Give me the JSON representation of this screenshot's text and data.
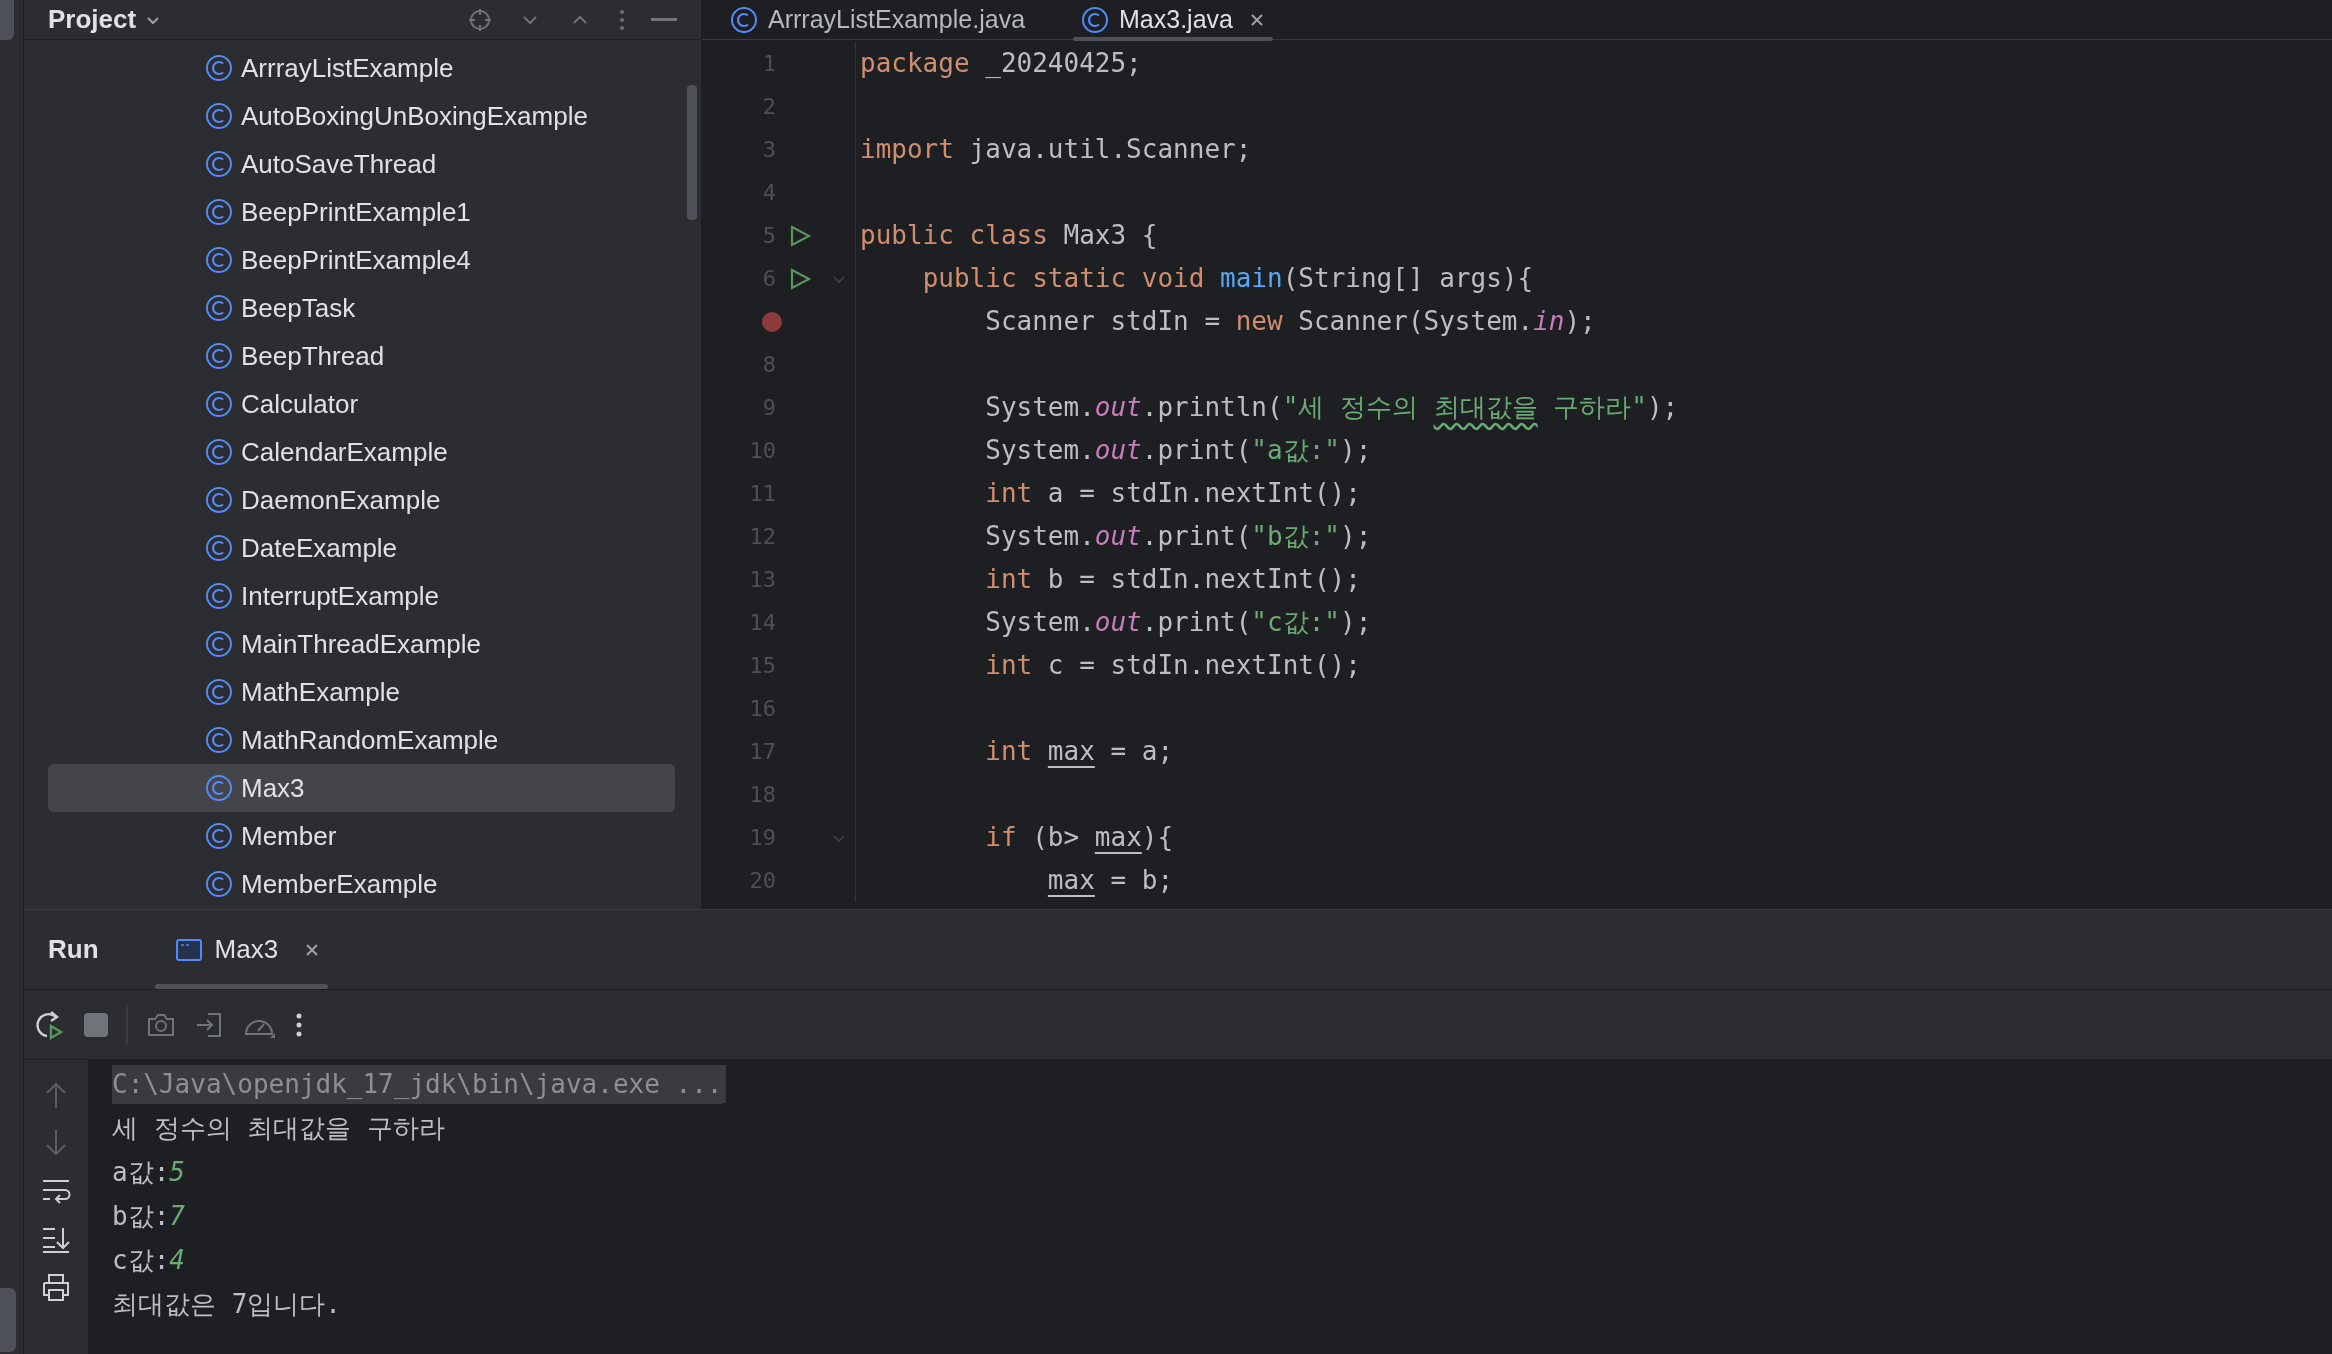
{
  "project_panel": {
    "title": "Project",
    "items": [
      {
        "label": "ArrrayListExample",
        "selected": false
      },
      {
        "label": "AutoBoxingUnBoxingExample",
        "selected": false
      },
      {
        "label": "AutoSaveThread",
        "selected": false
      },
      {
        "label": "BeepPrintExample1",
        "selected": false
      },
      {
        "label": "BeepPrintExample4",
        "selected": false
      },
      {
        "label": "BeepTask",
        "selected": false
      },
      {
        "label": "BeepThread",
        "selected": false
      },
      {
        "label": "Calculator",
        "selected": false
      },
      {
        "label": "CalendarExample",
        "selected": false
      },
      {
        "label": "DaemonExample",
        "selected": false
      },
      {
        "label": "DateExample",
        "selected": false
      },
      {
        "label": "InterruptExample",
        "selected": false
      },
      {
        "label": "MainThreadExample",
        "selected": false
      },
      {
        "label": "MathExample",
        "selected": false
      },
      {
        "label": "MathRandomExample",
        "selected": false
      },
      {
        "label": "Max3",
        "selected": true
      },
      {
        "label": "Member",
        "selected": false
      },
      {
        "label": "MemberExample",
        "selected": false
      }
    ]
  },
  "editor": {
    "tabs": [
      {
        "label": "ArrrayListExample.java",
        "selected": false
      },
      {
        "label": "Max3.java",
        "selected": true
      }
    ],
    "lines": [
      {
        "number": "1",
        "kind": "plain",
        "fold": false,
        "tokens": [
          {
            "text": "package",
            "kind": "keyword"
          },
          {
            "text": " _20240425;",
            "kind": "plain"
          }
        ]
      },
      {
        "number": "2",
        "kind": "plain",
        "fold": false
      },
      {
        "number": "3",
        "kind": "plain",
        "fold": false,
        "tokens": [
          {
            "text": "import",
            "kind": "keyword"
          },
          {
            "text": " java.util.Scanner;",
            "kind": "plain"
          }
        ]
      },
      {
        "number": "4",
        "kind": "plain",
        "fold": false
      },
      {
        "number": "5",
        "kind": "run",
        "fold": false,
        "tokens": [
          {
            "text": "public class",
            "kind": "keyword"
          },
          {
            "text": " Max3 {",
            "kind": "plain"
          }
        ]
      },
      {
        "number": "6",
        "kind": "run",
        "fold": true,
        "tokens": [
          {
            "text": "    public static void ",
            "kind": "keyword"
          },
          {
            "text": "main",
            "kind": "method"
          },
          {
            "text": "(String[] args){",
            "kind": "plain"
          }
        ]
      },
      {
        "kind": "breakpoint",
        "fold": false,
        "tokens": [
          {
            "text": "        Scanner stdIn = ",
            "kind": "plain"
          },
          {
            "text": "new",
            "kind": "keyword"
          },
          {
            "text": " Scanner(System.",
            "kind": "plain"
          },
          {
            "text": "in",
            "kind": "field"
          },
          {
            "text": ");",
            "kind": "plain"
          }
        ]
      },
      {
        "number": "8",
        "kind": "plain",
        "fold": false
      },
      {
        "number": "9",
        "kind": "plain",
        "fold": false,
        "tokens": [
          {
            "text": "        System.",
            "kind": "plain"
          },
          {
            "text": "out",
            "kind": "field"
          },
          {
            "text": ".println(",
            "kind": "plain"
          },
          {
            "text": "\"세 정수의 ",
            "kind": "string"
          },
          {
            "text": "최대값을",
            "kind": "typo"
          },
          {
            "text": " 구하라\"",
            "kind": "string"
          },
          {
            "text": ");",
            "kind": "plain"
          }
        ]
      },
      {
        "number": "10",
        "kind": "plain",
        "fold": false,
        "tokens": [
          {
            "text": "        System.",
            "kind": "plain"
          },
          {
            "text": "out",
            "kind": "field"
          },
          {
            "text": ".print(",
            "kind": "plain"
          },
          {
            "text": "\"a값:\"",
            "kind": "string"
          },
          {
            "text": ");",
            "kind": "plain"
          }
        ]
      },
      {
        "number": "11",
        "kind": "plain",
        "fold": false,
        "tokens": [
          {
            "text": "        int",
            "kind": "keyword"
          },
          {
            "text": " a = stdIn.nextInt();",
            "kind": "plain"
          }
        ]
      },
      {
        "number": "12",
        "kind": "plain",
        "fold": false,
        "tokens": [
          {
            "text": "        System.",
            "kind": "plain"
          },
          {
            "text": "out",
            "kind": "field"
          },
          {
            "text": ".print(",
            "kind": "plain"
          },
          {
            "text": "\"b값:\"",
            "kind": "string"
          },
          {
            "text": ");",
            "kind": "plain"
          }
        ]
      },
      {
        "number": "13",
        "kind": "plain",
        "fold": false,
        "tokens": [
          {
            "text": "        int",
            "kind": "keyword"
          },
          {
            "text": " b = stdIn.nextInt();",
            "kind": "plain"
          }
        ]
      },
      {
        "number": "14",
        "kind": "plain",
        "fold": false,
        "tokens": [
          {
            "text": "        System.",
            "kind": "plain"
          },
          {
            "text": "out",
            "kind": "field"
          },
          {
            "text": ".print(",
            "kind": "plain"
          },
          {
            "text": "\"c값:\"",
            "kind": "string"
          },
          {
            "text": ");",
            "kind": "plain"
          }
        ]
      },
      {
        "number": "15",
        "kind": "plain",
        "fold": false,
        "tokens": [
          {
            "text": "        int",
            "kind": "keyword"
          },
          {
            "text": " c = stdIn.nextInt();",
            "kind": "plain"
          }
        ]
      },
      {
        "number": "16",
        "kind": "plain",
        "fold": false
      },
      {
        "number": "17",
        "kind": "plain",
        "fold": false,
        "tokens": [
          {
            "text": "        int ",
            "kind": "keyword"
          },
          {
            "text": "max",
            "kind": "reassigned"
          },
          {
            "text": " = a;",
            "kind": "plain"
          }
        ]
      },
      {
        "number": "18",
        "kind": "plain",
        "fold": false
      },
      {
        "number": "19",
        "kind": "plain",
        "fold": true,
        "tokens": [
          {
            "text": "        if",
            "kind": "keyword"
          },
          {
            "text": " (b> ",
            "kind": "plain"
          },
          {
            "text": "max",
            "kind": "reassigned"
          },
          {
            "text": "){",
            "kind": "plain"
          }
        ]
      },
      {
        "number": "20",
        "kind": "plain",
        "fold": false,
        "tokens": [
          {
            "text": "            max",
            "kind": "reassigned"
          },
          {
            "text": " = b;",
            "kind": "plain"
          }
        ]
      }
    ]
  },
  "run_panel": {
    "title": "Run",
    "tabs": [
      {
        "label": "Max3",
        "selected": true
      }
    ],
    "console": [
      [
        {
          "text": "C:\\Java\\openjdk_17_jdk\\bin\\java.exe ...",
          "kind": "command"
        }
      ],
      [
        {
          "text": "세 정수의 최대값을 구하라",
          "kind": "output"
        }
      ],
      [
        {
          "text": "a값:",
          "kind": "output"
        },
        {
          "text": "5",
          "kind": "input"
        }
      ],
      [
        {
          "text": "b값:",
          "kind": "output"
        },
        {
          "text": "7",
          "kind": "input"
        }
      ],
      [
        {
          "text": "c값:",
          "kind": "output"
        },
        {
          "text": "4",
          "kind": "input"
        }
      ],
      [
        {
          "text": "최대값은 7입니다.",
          "kind": "output"
        }
      ]
    ]
  }
}
